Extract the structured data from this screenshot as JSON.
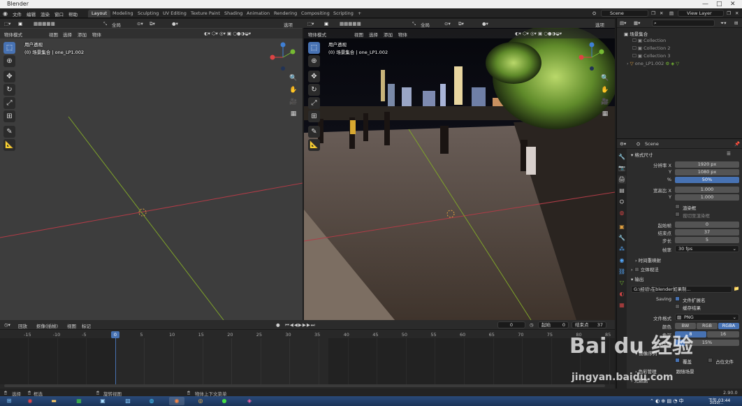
{
  "app": {
    "title": "Blender"
  },
  "menu": [
    "文件",
    "编辑",
    "渲染",
    "窗口",
    "帮助"
  ],
  "workspaces": [
    "Layout",
    "Modeling",
    "Sculpting",
    "UV Editing",
    "Texture Paint",
    "Shading",
    "Animation",
    "Rendering",
    "Compositing",
    "Scripting",
    "+"
  ],
  "scene_field": "Scene",
  "view_layer_field": "View Layer",
  "toolbar": {
    "orientation": "全局",
    "options": "选项"
  },
  "vp1": {
    "mode": "物体模式",
    "menu": [
      "视图",
      "选择",
      "添加",
      "物体"
    ],
    "view_name": "用户透视",
    "collection_line": "(0) 场景集合 | one_LP1.002"
  },
  "vp2": {
    "mode": "物体模式",
    "menu": [
      "视图",
      "选择",
      "添加",
      "物体"
    ],
    "view_name": "用户透视",
    "collection_line": "(0) 场景集合 | one_LP1.002",
    "orientation": "全局",
    "options": "选项"
  },
  "timeline": {
    "menu": [
      "回放",
      "抠像(插帧)",
      "视图",
      "标记"
    ],
    "current_frame": "0",
    "start_label": "起始",
    "start": "0",
    "end_label": "结束点",
    "end": "37",
    "ticks": [
      "-15",
      "-10",
      "-5",
      "0",
      "5",
      "10",
      "15",
      "20",
      "25",
      "30",
      "35",
      "40",
      "45",
      "50",
      "55",
      "60",
      "65",
      "70",
      "75",
      "80",
      "85"
    ]
  },
  "status": {
    "select": "选择",
    "box": "框选",
    "rotate": "旋转视图",
    "context": "物体上下文菜单",
    "version": "2.90.0"
  },
  "outliner": {
    "root": "场景集合",
    "items": [
      "Collection",
      "Collection 2",
      "Collection 3",
      "one_LP1.002"
    ]
  },
  "properties": {
    "scene": "Scene",
    "format_title": "格式尺寸",
    "res_x_label": "分辨率 X",
    "res_x": "1920 px",
    "y_label": "Y",
    "res_y": "1080 px",
    "pct_label": "%",
    "pct": "50%",
    "aspect_label": "宽高比 X",
    "aspect_x": "1.000",
    "aspect_y": "1.000",
    "border_label": "渲染框",
    "crop_label": "裁切至渲染框",
    "frame_start_label": "起始帧",
    "frame_start": "0",
    "frame_end_label": "结束点",
    "frame_end": "37",
    "step_label": "步长",
    "step": "5",
    "fps_label": "帧率",
    "fps": "30 fps",
    "time_remap": "时间重映射",
    "stereo": "立体视法",
    "output_title": "输出",
    "path": "G:\\经验\\在blender如果制...",
    "saving_label": "Saving",
    "ext_label": "文件扩展名",
    "cache_label": "缓存结果",
    "format_label": "文件格式",
    "format": "PNG",
    "color_label": "颜色",
    "color_opts": [
      "BW",
      "RGB",
      "RGBA"
    ],
    "depth_label": "色深",
    "depth_opts": [
      "8",
      "16"
    ],
    "compress_label": "压缩",
    "compress": "15%",
    "image_seq": "图像序列",
    "overwrite_label": "覆盖",
    "placeholder_label": "占位文件",
    "color_manage": "色彩管理",
    "color_manage_val": "跟随场景",
    "metadata": "元数据"
  },
  "taskbar": {
    "time": "下午 03:44",
    "date": "2020/..."
  },
  "watermark": {
    "logo": "Bai du 经验",
    "url": "jingyan.baidu.com"
  }
}
